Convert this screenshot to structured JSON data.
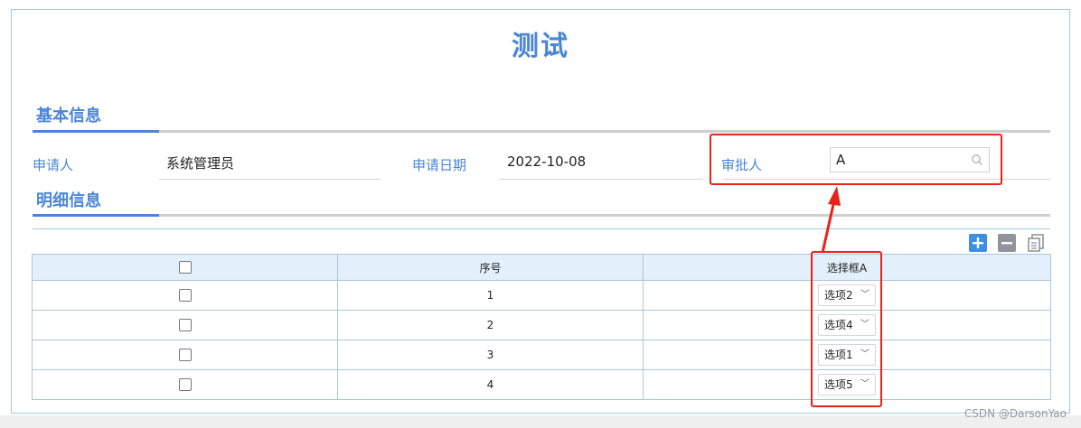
{
  "page": {
    "title": "测试"
  },
  "sections": {
    "basic": {
      "title": "基本信息"
    },
    "detail": {
      "title": "明细信息"
    }
  },
  "fields": {
    "applicant": {
      "label": "申请人",
      "value": "系统管理员"
    },
    "apply_date": {
      "label": "申请日期",
      "value": "2022-10-08"
    },
    "approver": {
      "label": "审批人",
      "value": "A",
      "icon": "search-icon"
    }
  },
  "toolbar": {
    "add_icon": "plus-icon",
    "remove_icon": "minus-icon",
    "copy_icon": "copy-icon"
  },
  "table": {
    "headers": {
      "check": "",
      "index": "序号",
      "select": "选择框A"
    },
    "rows": [
      {
        "index": "1",
        "select": "选项2"
      },
      {
        "index": "2",
        "select": "选项4"
      },
      {
        "index": "3",
        "select": "选项1"
      },
      {
        "index": "4",
        "select": "选项5"
      }
    ]
  },
  "colors": {
    "accent": "#4a86d8",
    "annotation": "#e8231b",
    "header_bg": "#e3f0fb",
    "border": "#a9c7da"
  },
  "watermark": "CSDN @DarsonYao"
}
